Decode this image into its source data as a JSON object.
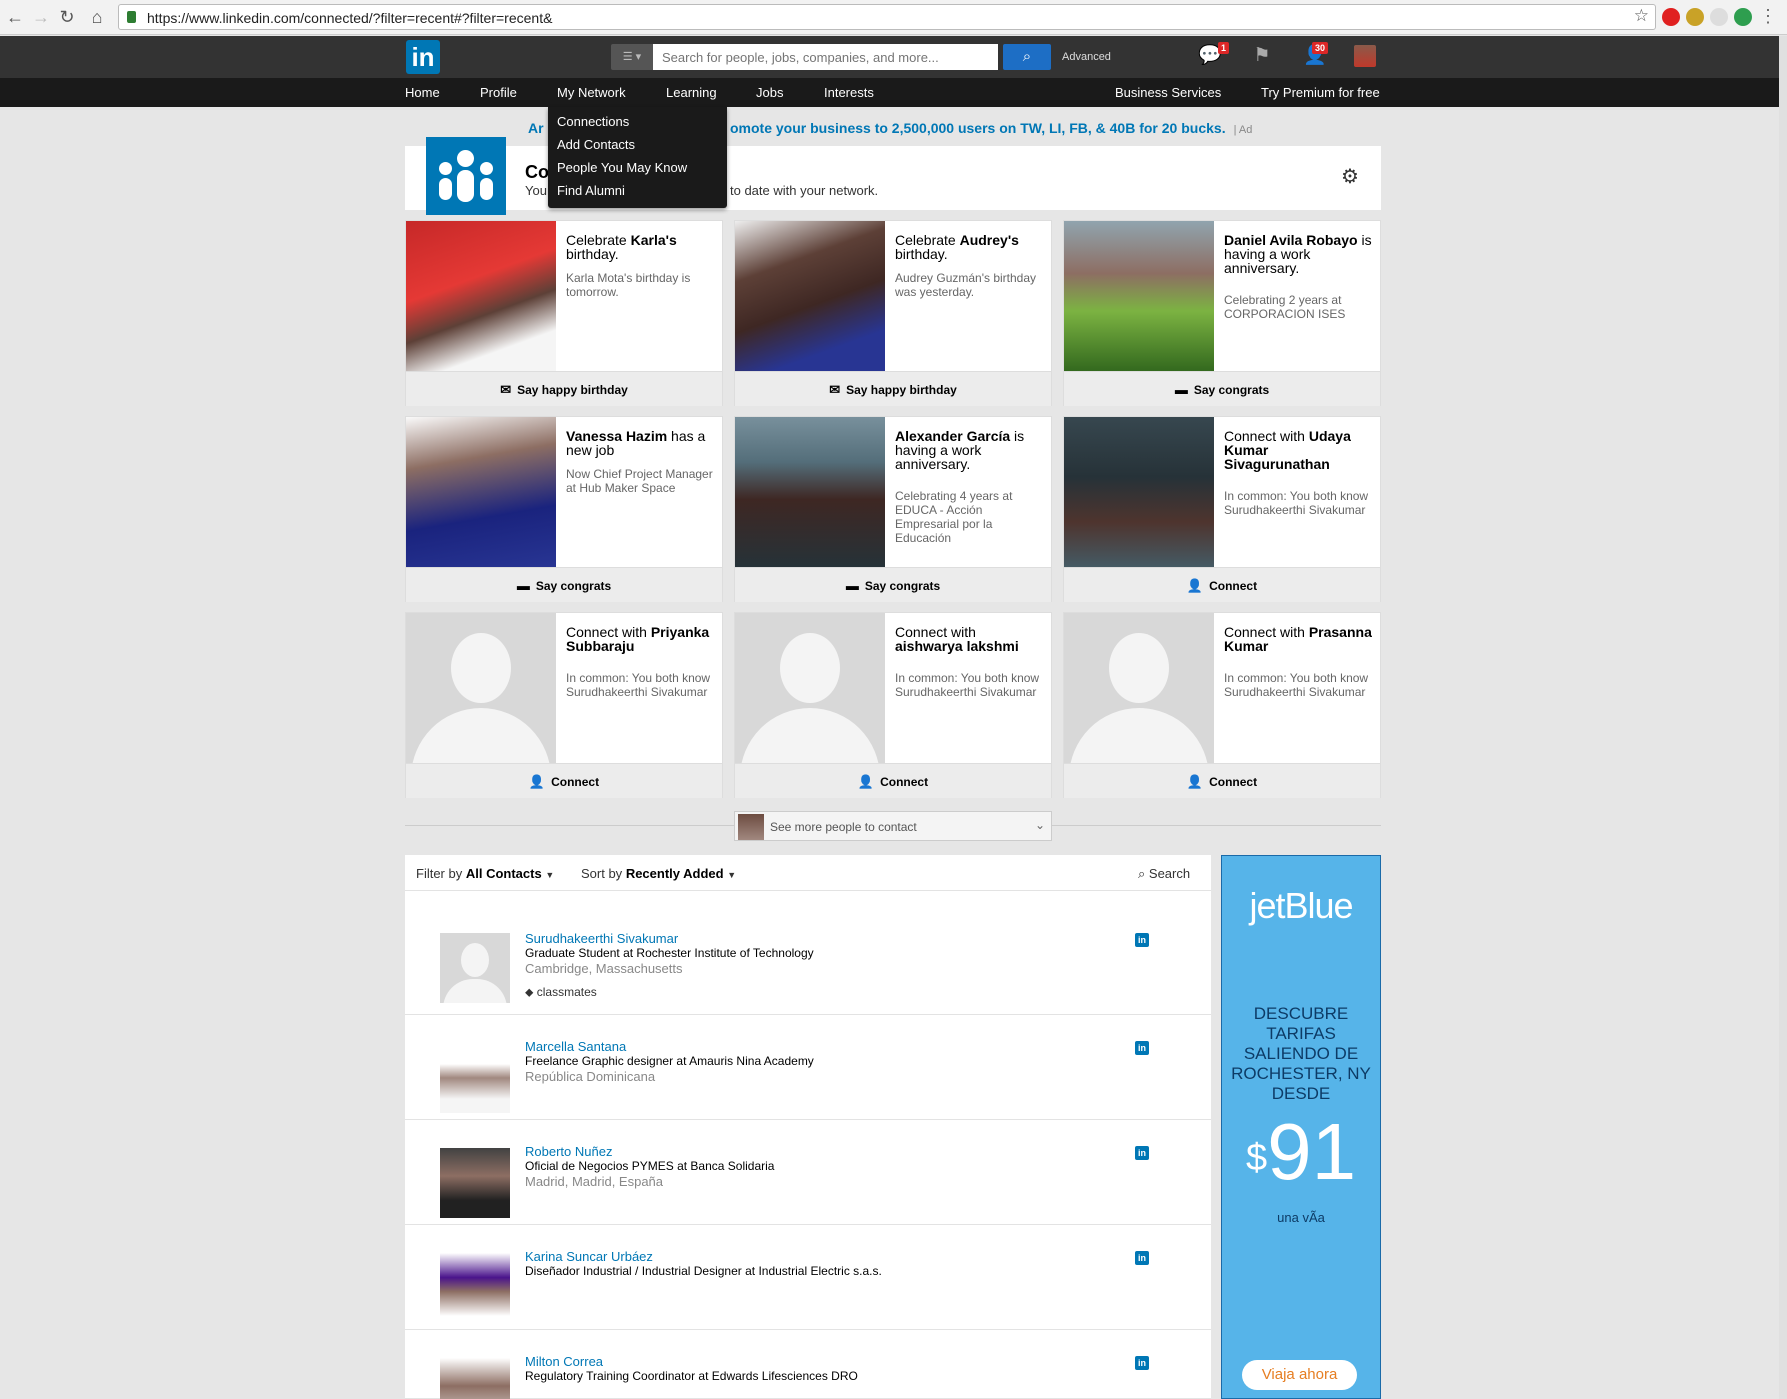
{
  "browser": {
    "url": "https://www.linkedin.com/connected/?filter=recent#?filter=recent&"
  },
  "header": {
    "logo": "in",
    "search_placeholder": "Search for people, jobs, companies, and more...",
    "advanced_label": "Advanced",
    "messages_badge": "1",
    "invites_badge": "30"
  },
  "nav": {
    "items": [
      "Home",
      "Profile",
      "My Network",
      "Learning",
      "Jobs",
      "Interests"
    ],
    "business": "Business Services",
    "premium": "Try Premium for free"
  },
  "dropdown": [
    "Connections",
    "Add Contacts",
    "People You May Know",
    "Find Alumni"
  ],
  "ad_line": {
    "left": "Ar",
    "right": "omote your business to 2,500,000 users on TW, LI, FB, & 40B for 20 bucks.",
    "tag": "Ad"
  },
  "connected": {
    "title": "Co",
    "subtitle_left": "You",
    "subtitle_right": "to date with your network."
  },
  "cards": [
    {
      "title_pre": "Celebrate ",
      "title_bold": "Karla's",
      "title_post": " birthday.",
      "desc": "Karla Mota's birthday is tomorrow.",
      "action": "Say happy birthday",
      "icon": "envelope-icon"
    },
    {
      "title_pre": "Celebrate ",
      "title_bold": "Audrey's",
      "title_post": " birthday.",
      "desc": "Audrey Guzmán's birthday was yesterday.",
      "action": "Say happy birthday",
      "icon": "envelope-icon"
    },
    {
      "title_pre": "",
      "title_bold": "Daniel Avila Robayo",
      "title_post": " is having a work anniversary.",
      "desc": "Celebrating 2 years at CORPORACION ISES",
      "action": "Say congrats",
      "icon": "speech-bubble-icon"
    },
    {
      "title_pre": "",
      "title_bold": "Vanessa Hazim",
      "title_post": " has a new job",
      "desc": "Now Chief Project Manager at Hub Maker Space",
      "action": "Say congrats",
      "icon": "speech-bubble-icon"
    },
    {
      "title_pre": "",
      "title_bold": "Alexander García",
      "title_post": " is having a work anniversary.",
      "desc": "Celebrating 4 years at EDUCA - Acción Empresarial por la Educación",
      "action": "Say congrats",
      "icon": "speech-bubble-icon"
    },
    {
      "title_pre": "Connect with ",
      "title_bold": "Udaya Kumar Sivagurunathan",
      "title_post": "",
      "desc": "In common: You both know Surudhakeerthi Sivakumar",
      "action": "Connect",
      "icon": "add-person-icon"
    },
    {
      "title_pre": "Connect with ",
      "title_bold": "Priyanka Subbaraju",
      "title_post": "",
      "desc": "In common: You both know Surudhakeerthi Sivakumar",
      "action": "Connect",
      "icon": "add-person-icon"
    },
    {
      "title_pre": "Connect with ",
      "title_bold": "aishwarya lakshmi",
      "title_post": "",
      "desc": "In common: You both know Surudhakeerthi Sivakumar",
      "action": "Connect",
      "icon": "add-person-icon"
    },
    {
      "title_pre": "Connect with ",
      "title_bold": "Prasanna Kumar",
      "title_post": "",
      "desc": "In common: You both know Surudhakeerthi Sivakumar",
      "action": "Connect",
      "icon": "add-person-icon"
    }
  ],
  "see_more": "See more people to contact",
  "filter": {
    "filter_prefix": "Filter by",
    "filter_value": "All Contacts",
    "sort_prefix": "Sort by",
    "sort_value": "Recently Added",
    "search": "Search"
  },
  "contacts": [
    {
      "name": "Surudhakeerthi Sivakumar",
      "job": "Graduate Student at Rochester Institute of Technology",
      "location": "Cambridge, Massachusetts",
      "tag": "classmates"
    },
    {
      "name": "Marcella Santana",
      "job": "Freelance Graphic designer at Amauris Nina Academy",
      "location": "República Dominicana",
      "tag": ""
    },
    {
      "name": "Roberto Nuñez",
      "job": "Oficial de Negocios PYMES at Banca Solidaria",
      "location": "Madrid, Madrid, España",
      "tag": ""
    },
    {
      "name": "Karina Suncar Urbáez",
      "job": "Diseñador Industrial / Industrial Designer at Industrial Electric s.a.s.",
      "location": "",
      "tag": ""
    },
    {
      "name": "Milton Correa",
      "job": "Regulatory Training Coordinator at Edwards Lifesciences DRO",
      "location": "",
      "tag": ""
    }
  ],
  "jetblue": {
    "logo": "jetBlue",
    "headline": "DESCUBRE TARIFAS SALIENDO DE ROCHESTER, NY DESDE",
    "currency": "$",
    "price": "91",
    "via": "una vÃa",
    "button": "Viaja ahora"
  },
  "colors": {
    "linkedin_blue": "#0077b5",
    "header_dark": "#333333",
    "nav_black": "#1a1a1a",
    "jetblue_bg": "#56b4e9"
  }
}
